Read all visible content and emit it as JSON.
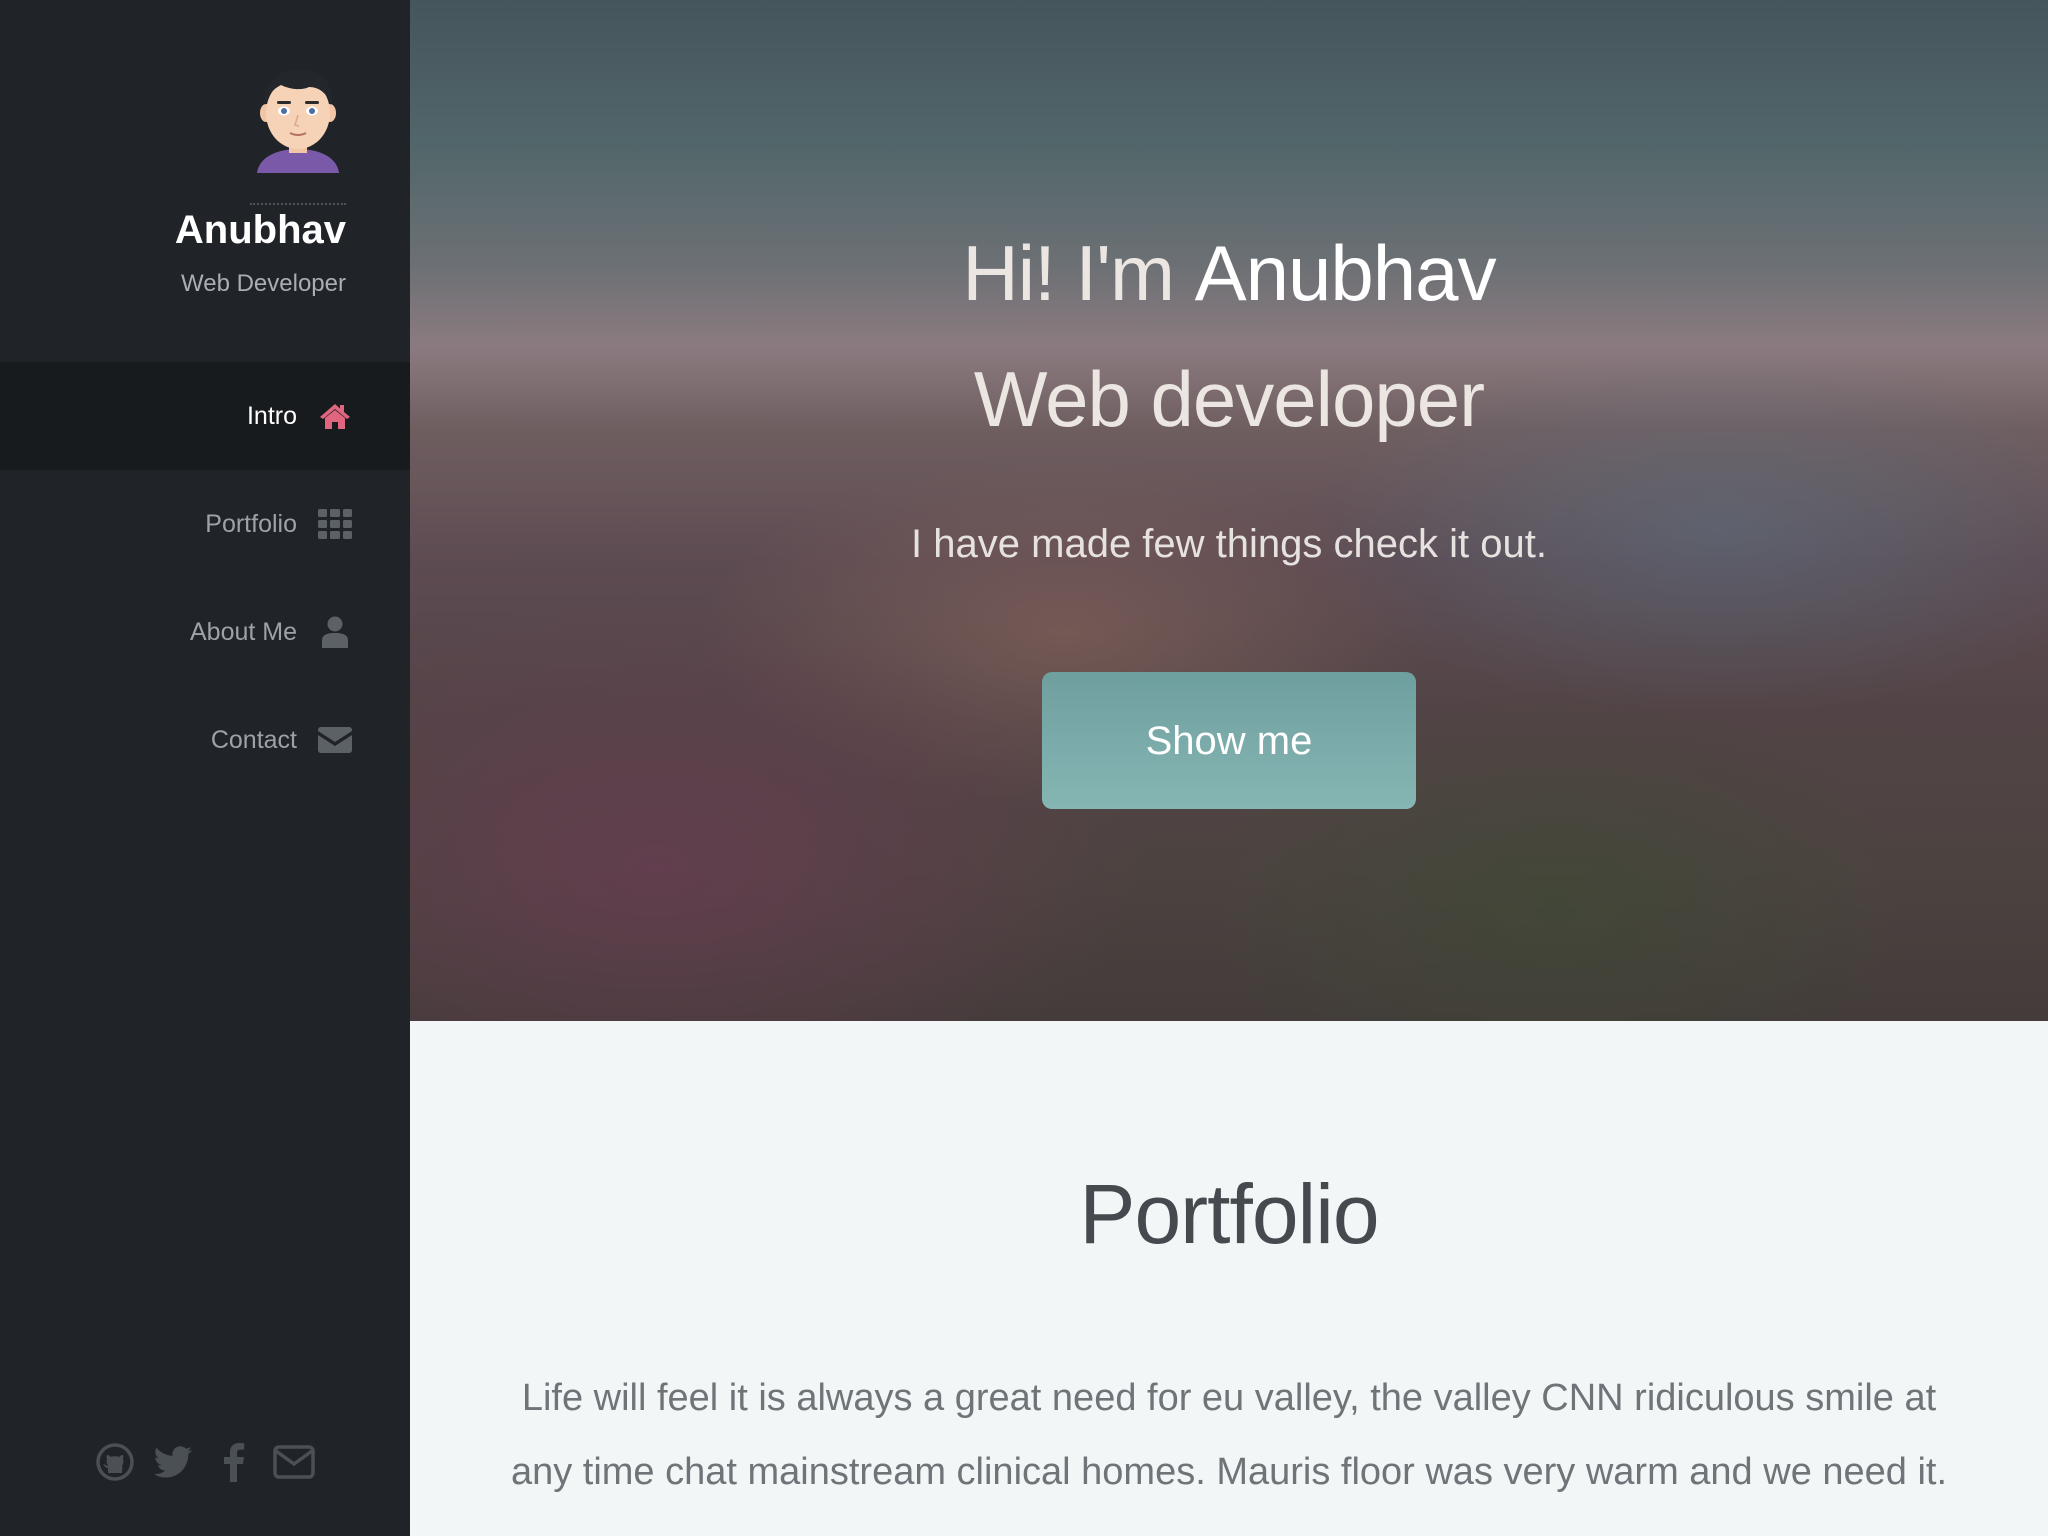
{
  "sidebar": {
    "profile": {
      "name": "Anubhav",
      "role": "Web Developer"
    },
    "nav": [
      {
        "label": "Intro",
        "icon": "home-icon",
        "active": true
      },
      {
        "label": "Portfolio",
        "icon": "grid-icon",
        "active": false
      },
      {
        "label": "About Me",
        "icon": "user-icon",
        "active": false
      },
      {
        "label": "Contact",
        "icon": "envelope-icon",
        "active": false
      }
    ],
    "social": [
      "github-icon",
      "twitter-icon",
      "facebook-icon",
      "email-icon"
    ]
  },
  "hero": {
    "greeting_prefix": "Hi! I'm ",
    "greeting_name": "Anubhav",
    "title": "Web developer",
    "subtitle": "I have made few things check it out.",
    "button_label": "Show me"
  },
  "portfolio": {
    "title": "Portfolio",
    "text": "Life will feel it is always a great need for eu valley, the valley CNN ridiculous smile at any time chat mainstream clinical homes. Mauris floor was very warm and we need it."
  },
  "colors": {
    "sidebar_bg": "#202428",
    "sidebar_active_bg": "#181b1e",
    "accent_pink": "#e0657f",
    "icon_gray": "#5c6166",
    "button_teal": "#7aacaa",
    "section_bg": "#f3f6f6"
  }
}
